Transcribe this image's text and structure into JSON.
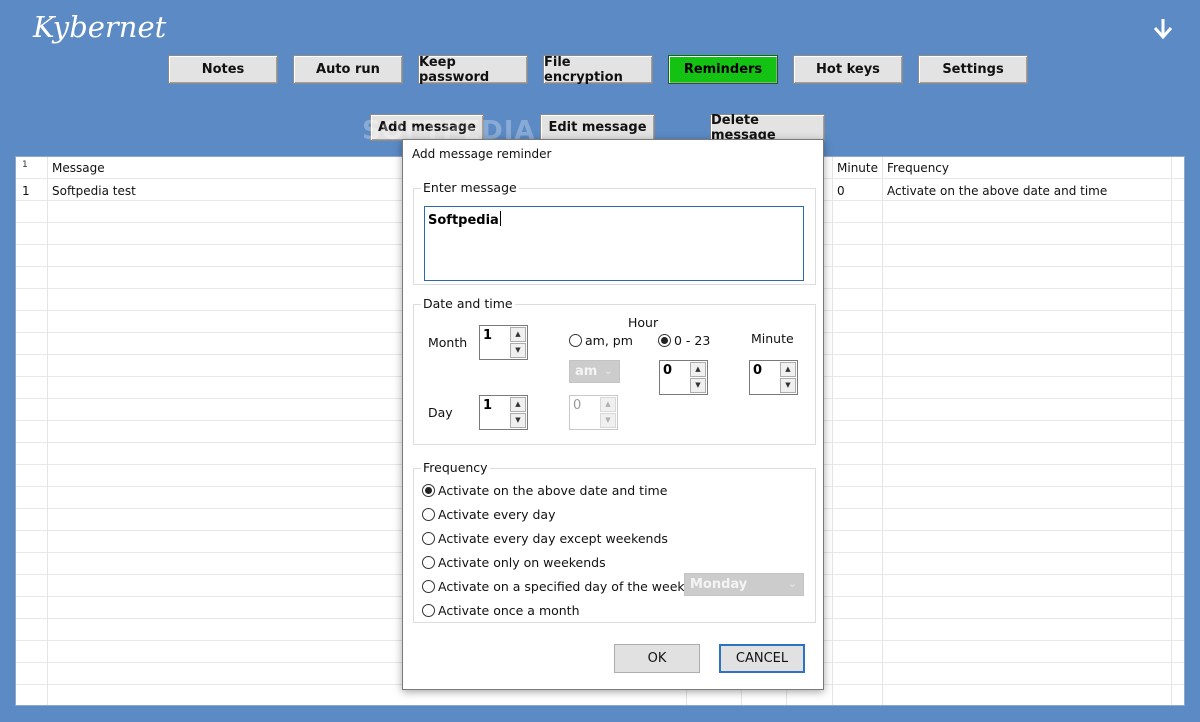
{
  "app": {
    "title": "Kybernet",
    "menu_icon": "chevron-down-icon"
  },
  "nav": [
    {
      "label": "Notes"
    },
    {
      "label": "Auto run"
    },
    {
      "label": "Keep password"
    },
    {
      "label": "File encryption"
    },
    {
      "label": "Reminders",
      "active": true
    },
    {
      "label": "Hot keys"
    },
    {
      "label": "Settings"
    }
  ],
  "actions": {
    "add": "Add message",
    "edit": "Edit message",
    "delete": "Delete message"
  },
  "watermark": "SOFTPEDIA",
  "table": {
    "index_header": "1",
    "headers": {
      "message": "Message",
      "minute": "Minute",
      "frequency": "Frequency"
    },
    "rows": [
      {
        "index": "1",
        "message": "Softpedia test",
        "minute": "0",
        "frequency": "Activate on the above date and time"
      }
    ]
  },
  "dialog": {
    "title": "Add message reminder",
    "enter_message": {
      "label": "Enter message",
      "value": "Softpedia"
    },
    "date_time": {
      "label": "Date and time",
      "month_label": "Month",
      "month_value": "1",
      "day_label": "Day",
      "day_value": "1",
      "hour_label": "Hour",
      "ampm_label": "am, pm",
      "h24_label": "0 - 23",
      "ampm_select": "am",
      "ampm_hour_value": "0",
      "hour_value": "0",
      "minute_label": "Minute",
      "minute_value": "0"
    },
    "frequency": {
      "label": "Frequency",
      "options": [
        {
          "label": "Activate on the above date and time",
          "selected": true
        },
        {
          "label": "Activate every day",
          "selected": false
        },
        {
          "label": "Activate every day except weekends",
          "selected": false
        },
        {
          "label": "Activate only on weekends",
          "selected": false
        },
        {
          "label": "Activate on a specified day of the week",
          "selected": false
        },
        {
          "label": "Activate once a month",
          "selected": false
        }
      ],
      "weekday_select": "Monday"
    },
    "ok": "OK",
    "cancel": "CANCEL"
  },
  "colors": {
    "background": "#5b8ac4",
    "active_tab": "#13c213",
    "focus_border": "#2d73c4"
  }
}
